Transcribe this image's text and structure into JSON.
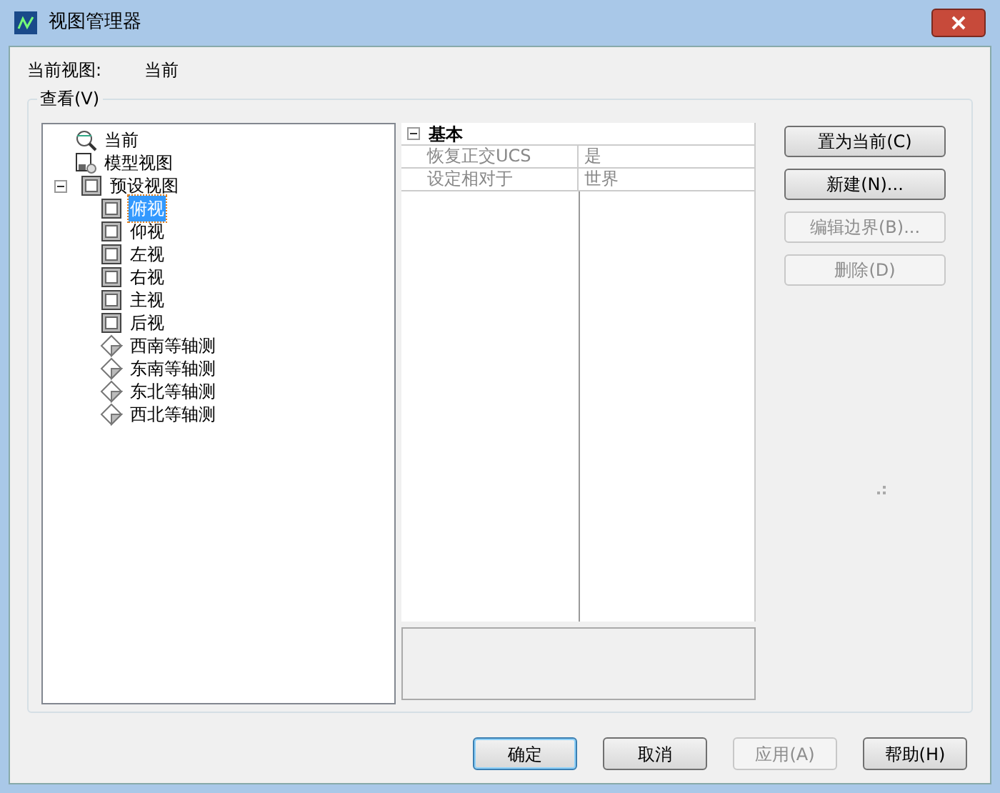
{
  "window": {
    "title": "视图管理器"
  },
  "current_view": {
    "label": "当前视图:",
    "value": "当前"
  },
  "group": {
    "label": "查看(V)"
  },
  "tree": [
    {
      "label": "当前",
      "kind": "camera",
      "selected": false
    },
    {
      "label": "模型视图",
      "kind": "model",
      "selected": false
    },
    {
      "label": "预设视图",
      "kind": "box",
      "selected": false,
      "expanded": true,
      "children": [
        {
          "label": "俯视",
          "kind": "box",
          "selected": true
        },
        {
          "label": "仰视",
          "kind": "box",
          "selected": false
        },
        {
          "label": "左视",
          "kind": "box",
          "selected": false
        },
        {
          "label": "右视",
          "kind": "box",
          "selected": false
        },
        {
          "label": "主视",
          "kind": "box",
          "selected": false
        },
        {
          "label": "后视",
          "kind": "box",
          "selected": false
        },
        {
          "label": "西南等轴测",
          "kind": "iso",
          "selected": false
        },
        {
          "label": "东南等轴测",
          "kind": "iso",
          "selected": false
        },
        {
          "label": "东北等轴测",
          "kind": "iso",
          "selected": false
        },
        {
          "label": "西北等轴测",
          "kind": "iso",
          "selected": false
        }
      ]
    }
  ],
  "properties": {
    "section": "基本",
    "expanded": true,
    "rows": [
      {
        "name": "恢复正交UCS",
        "value": "是"
      },
      {
        "name": "设定相对于",
        "value": "世界"
      }
    ]
  },
  "side_buttons": [
    {
      "label": "置为当前(C)",
      "disabled": false
    },
    {
      "label": "新建(N)...",
      "disabled": false
    },
    {
      "label": "编辑边界(B)...",
      "disabled": true
    },
    {
      "label": "删除(D)",
      "disabled": true
    }
  ],
  "footer_buttons": [
    {
      "label": "确定",
      "disabled": false,
      "default": true
    },
    {
      "label": "取消",
      "disabled": false,
      "default": false
    },
    {
      "label": "应用(A)",
      "disabled": true,
      "default": false
    },
    {
      "label": "帮助(H)",
      "disabled": false,
      "default": false
    }
  ]
}
